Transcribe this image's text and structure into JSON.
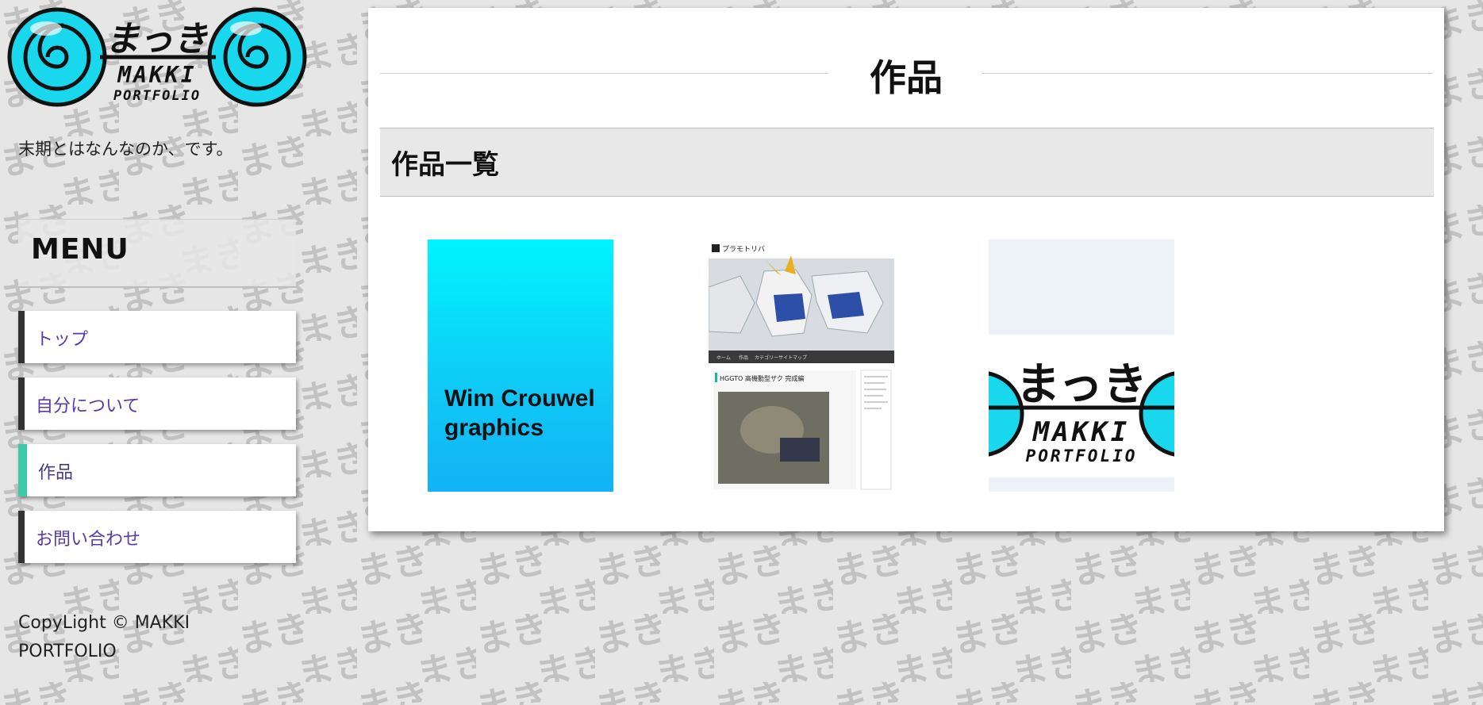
{
  "site": {
    "logo": {
      "jp_text": "まっき",
      "name": "MAKKI",
      "sub": "PORTFOLIO"
    },
    "tagline": "末期とはなんなのか、です。"
  },
  "menu": {
    "title": "MENU",
    "items": [
      {
        "label": "トップ",
        "active": false
      },
      {
        "label": "自分について",
        "active": false
      },
      {
        "label": "作品",
        "active": true
      },
      {
        "label": "お問い合わせ",
        "active": false
      }
    ]
  },
  "footer": {
    "copyright": "CopyLight © MAKKI PORTFOLIO"
  },
  "main": {
    "page_title": "作品",
    "section_title": "作品一覧",
    "works": [
      {
        "thumbnail_text": "Wim Crouwel graphics"
      },
      {
        "thumbnail_header": "プラモトリバ",
        "thumbnail_post_title": "HGGTO 高機動型ザク 完成編",
        "thumbnail_nav": [
          "ホーム",
          "作品",
          "カテゴリー",
          "サイトマップ"
        ]
      },
      {
        "logo": {
          "jp_text": "まっき",
          "name": "MAKKI",
          "sub": "PORTFOLIO"
        }
      }
    ]
  },
  "colors": {
    "accent_active": "#3cc9a6",
    "menu_border": "#333333",
    "link": "#5a3aa8",
    "logo_cyan": "#19d8ee",
    "background": "#e6e6e6"
  },
  "icons": [
    "swirl-icon"
  ]
}
